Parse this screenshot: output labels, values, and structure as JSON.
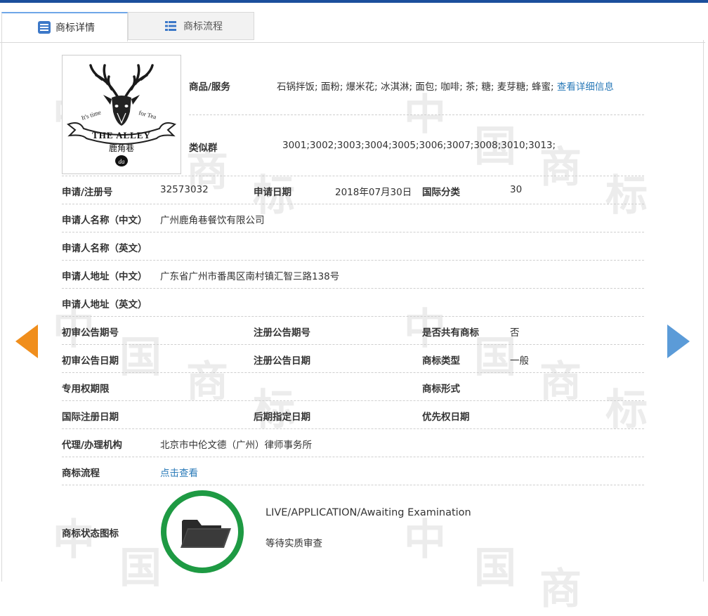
{
  "tabs": [
    {
      "label": "商标详情",
      "icon": "document-list-icon",
      "active": true
    },
    {
      "label": "商标流程",
      "icon": "list-icon",
      "active": false
    }
  ],
  "logo": {
    "line1": "It's time",
    "line2": "for Tea",
    "brand": "THE ALLEY",
    "cn": "鹿角巷",
    "mark": "da"
  },
  "goods": {
    "label": "商品/服务",
    "value": "石锅拌饭; 面粉; 爆米花; 冰淇淋; 面包; 咖啡; 茶; 糖; 麦芽糖; 蜂蜜;",
    "link": "查看详细信息"
  },
  "similar_group": {
    "label": "类似群",
    "value": "3001;3002;3003;3004;3005;3006;3007;3008;3010;3013;"
  },
  "fields": {
    "reg_no_label": "申请/注册号",
    "reg_no": "32573032",
    "app_date_label": "申请日期",
    "app_date": "2018年07月30日",
    "intl_class_label": "国际分类",
    "intl_class": "30",
    "applicant_cn_label": "申请人名称（中文）",
    "applicant_cn": "广州鹿角巷餐饮有限公司",
    "applicant_en_label": "申请人名称（英文）",
    "applicant_en": "",
    "address_cn_label": "申请人地址（中文）",
    "address_cn": "广东省广州市番禺区南村镇汇智三路138号",
    "address_en_label": "申请人地址（英文）",
    "address_en": "",
    "prelim_pub_no_label": "初审公告期号",
    "prelim_pub_no": "",
    "reg_pub_no_label": "注册公告期号",
    "reg_pub_no": "",
    "shared_label": "是否共有商标",
    "shared": "否",
    "prelim_pub_date_label": "初审公告日期",
    "prelim_pub_date": "",
    "reg_pub_date_label": "注册公告日期",
    "reg_pub_date": "",
    "type_label": "商标类型",
    "type": "一般",
    "exclusive_period_label": "专用权期限",
    "exclusive_period": "",
    "form_label": "商标形式",
    "form": "",
    "intl_reg_date_label": "国际注册日期",
    "intl_reg_date": "",
    "later_date_label": "后期指定日期",
    "later_date": "",
    "priority_date_label": "优先权日期",
    "priority_date": "",
    "agent_label": "代理/办理机构",
    "agent": "北京市中伦文德（广州）律师事务所",
    "process_label": "商标流程",
    "process_link": "点击查看",
    "status_icon_label": "商标状态图标",
    "status_en": "LIVE/APPLICATION/Awaiting Examination",
    "status_cn": "等待实质审查"
  },
  "watermark": {
    "chars": [
      "中",
      "国",
      "商",
      "标"
    ]
  },
  "colors": {
    "accent": "#1b4f9c",
    "link": "#2a7ab8",
    "prev_arrow": "#f08e1c",
    "next_arrow": "#5b9bd8",
    "status_ring": "#1e9a43"
  }
}
